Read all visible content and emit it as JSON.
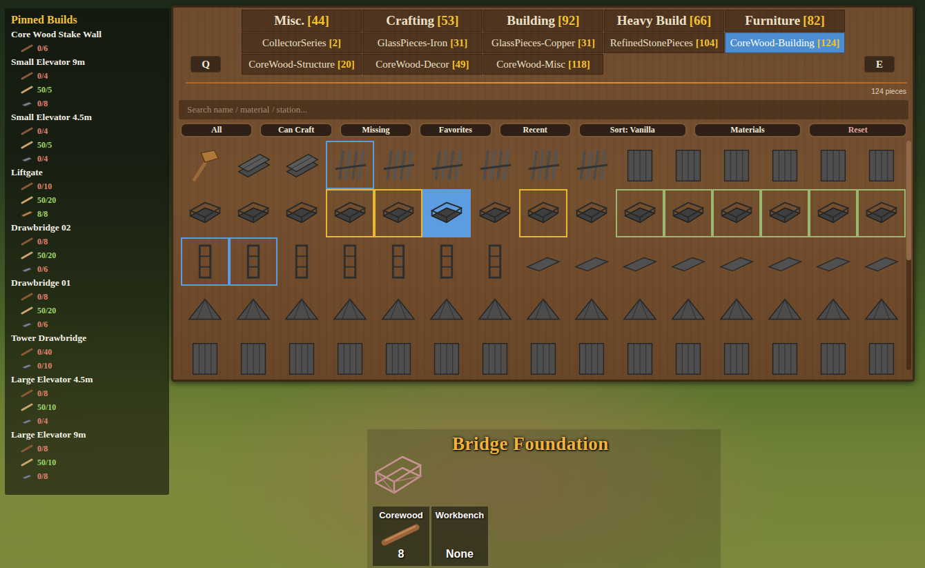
{
  "pinned": {
    "title": "Pinned Builds",
    "items": [
      {
        "name": "Core Wood Stake Wall",
        "requirements": [
          {
            "kind": "corewood",
            "amount": "0/6",
            "met": false
          }
        ]
      },
      {
        "name": "Small Elevator 9m",
        "requirements": [
          {
            "kind": "corewood",
            "amount": "0/4",
            "met": false
          },
          {
            "kind": "finewood",
            "amount": "50/5",
            "met": true
          },
          {
            "kind": "metal",
            "amount": "0/8",
            "met": false
          }
        ]
      },
      {
        "name": "Small Elevator 4.5m",
        "requirements": [
          {
            "kind": "corewood",
            "amount": "0/4",
            "met": false
          },
          {
            "kind": "finewood",
            "amount": "50/5",
            "met": true
          },
          {
            "kind": "metal",
            "amount": "0/4",
            "met": false
          }
        ]
      },
      {
        "name": "Liftgate",
        "requirements": [
          {
            "kind": "corewood",
            "amount": "0/10",
            "met": false
          },
          {
            "kind": "finewood",
            "amount": "50/20",
            "met": true
          },
          {
            "kind": "plank",
            "amount": "8/8",
            "met": true
          }
        ]
      },
      {
        "name": "Drawbridge 02",
        "requirements": [
          {
            "kind": "corewood",
            "amount": "0/8",
            "met": false
          },
          {
            "kind": "finewood",
            "amount": "50/20",
            "met": true
          },
          {
            "kind": "metal",
            "amount": "0/6",
            "met": false
          }
        ]
      },
      {
        "name": "Drawbridge 01",
        "requirements": [
          {
            "kind": "corewood",
            "amount": "0/8",
            "met": false
          },
          {
            "kind": "finewood",
            "amount": "50/20",
            "met": true
          },
          {
            "kind": "metal",
            "amount": "0/6",
            "met": false
          }
        ]
      },
      {
        "name": "Tower Drawbridge",
        "requirements": [
          {
            "kind": "corewood",
            "amount": "0/40",
            "met": false
          },
          {
            "kind": "metal",
            "amount": "0/10",
            "met": false
          }
        ]
      },
      {
        "name": "Large Elevator 4.5m",
        "requirements": [
          {
            "kind": "corewood",
            "amount": "0/8",
            "met": false
          },
          {
            "kind": "finewood",
            "amount": "50/10",
            "met": true
          },
          {
            "kind": "metal",
            "amount": "0/4",
            "met": false
          }
        ]
      },
      {
        "name": "Large Elevator 9m",
        "requirements": [
          {
            "kind": "corewood",
            "amount": "0/8",
            "met": false
          },
          {
            "kind": "finewood",
            "amount": "50/10",
            "met": true
          },
          {
            "kind": "metal",
            "amount": "0/8",
            "met": false
          }
        ]
      }
    ]
  },
  "nav": {
    "prev": "Q",
    "next": "E"
  },
  "tabs": [
    {
      "label": "Misc.",
      "count": "[44]",
      "selected": false,
      "size": "large"
    },
    {
      "label": "Crafting",
      "count": "[53]",
      "selected": false,
      "size": "large"
    },
    {
      "label": "Building",
      "count": "[92]",
      "selected": false,
      "size": "large"
    },
    {
      "label": "Heavy Build",
      "count": "[66]",
      "selected": false,
      "size": "large"
    },
    {
      "label": "Furniture",
      "count": "[82]",
      "selected": false,
      "size": "large"
    },
    {
      "label": "CollectorSeries",
      "count": "[2]",
      "selected": false,
      "size": "small"
    },
    {
      "label": "GlassPieces-Iron",
      "count": "[31]",
      "selected": false,
      "size": "small"
    },
    {
      "label": "GlassPieces-Copper",
      "count": "[31]",
      "selected": false,
      "size": "small"
    },
    {
      "label": "RefinedStonePieces",
      "count": "[104]",
      "selected": false,
      "size": "small"
    },
    {
      "label": "CoreWood-Building",
      "count": "[124]",
      "selected": true,
      "size": "small"
    },
    {
      "label": "CoreWood-Structure",
      "count": "[20]",
      "selected": false,
      "size": "small"
    },
    {
      "label": "CoreWood-Decor",
      "count": "[49]",
      "selected": false,
      "size": "small"
    },
    {
      "label": "CoreWood-Misc",
      "count": "[118]",
      "selected": false,
      "size": "small"
    }
  ],
  "piece_count": "124 pieces",
  "search": {
    "placeholder": "Search name / material / station..."
  },
  "filters": [
    {
      "label": "All",
      "kind": "normal"
    },
    {
      "label": "Can Craft",
      "kind": "normal"
    },
    {
      "label": "Missing",
      "kind": "normal"
    },
    {
      "label": "Favorites",
      "kind": "normal"
    },
    {
      "label": "Recent",
      "kind": "normal"
    },
    {
      "label": "Sort: Vanilla",
      "kind": "normal"
    },
    {
      "label": "Materials",
      "kind": "normal"
    },
    {
      "label": "Reset",
      "kind": "reset"
    }
  ],
  "pieces": [
    {
      "selected": false,
      "color": ""
    },
    {
      "selected": false,
      "color": ""
    },
    {
      "selected": false,
      "color": ""
    },
    {
      "selected": false,
      "color": "#5b9de0"
    },
    {
      "selected": false,
      "color": ""
    },
    {
      "selected": false,
      "color": ""
    },
    {
      "selected": false,
      "color": ""
    },
    {
      "selected": false,
      "color": ""
    },
    {
      "selected": false,
      "color": ""
    },
    {
      "selected": false,
      "color": ""
    },
    {
      "selected": false,
      "color": ""
    },
    {
      "selected": false,
      "color": ""
    },
    {
      "selected": false,
      "color": ""
    },
    {
      "selected": false,
      "color": ""
    },
    {
      "selected": false,
      "color": ""
    },
    {
      "selected": false,
      "color": ""
    },
    {
      "selected": false,
      "color": ""
    },
    {
      "selected": false,
      "color": ""
    },
    {
      "selected": false,
      "color": "#e8b830"
    },
    {
      "selected": false,
      "color": "#e8b830"
    },
    {
      "selected": true,
      "color": "#5b9de0"
    },
    {
      "selected": false,
      "color": ""
    },
    {
      "selected": false,
      "color": "#e8b830"
    },
    {
      "selected": false,
      "color": ""
    },
    {
      "selected": false,
      "color": "#9ab870"
    },
    {
      "selected": false,
      "color": "#9ab870"
    },
    {
      "selected": false,
      "color": "#9ab870"
    },
    {
      "selected": false,
      "color": "#9ab870"
    },
    {
      "selected": false,
      "color": "#9ab870"
    },
    {
      "selected": false,
      "color": "#9ab870"
    },
    {
      "selected": false,
      "color": "#5b9de0"
    },
    {
      "selected": false,
      "color": "#5b9de0"
    },
    {
      "selected": false,
      "color": ""
    },
    {
      "selected": false,
      "color": ""
    },
    {
      "selected": false,
      "color": ""
    },
    {
      "selected": false,
      "color": ""
    },
    {
      "selected": false,
      "color": ""
    },
    {
      "selected": false,
      "color": ""
    },
    {
      "selected": false,
      "color": ""
    },
    {
      "selected": false,
      "color": ""
    },
    {
      "selected": false,
      "color": ""
    },
    {
      "selected": false,
      "color": ""
    },
    {
      "selected": false,
      "color": ""
    },
    {
      "selected": false,
      "color": ""
    },
    {
      "selected": false,
      "color": ""
    },
    {
      "selected": false,
      "color": ""
    },
    {
      "selected": false,
      "color": ""
    },
    {
      "selected": false,
      "color": ""
    },
    {
      "selected": false,
      "color": ""
    },
    {
      "selected": false,
      "color": ""
    },
    {
      "selected": false,
      "color": ""
    },
    {
      "selected": false,
      "color": ""
    },
    {
      "selected": false,
      "color": ""
    },
    {
      "selected": false,
      "color": ""
    },
    {
      "selected": false,
      "color": ""
    },
    {
      "selected": false,
      "color": ""
    },
    {
      "selected": false,
      "color": ""
    },
    {
      "selected": false,
      "color": ""
    },
    {
      "selected": false,
      "color": ""
    },
    {
      "selected": false,
      "color": ""
    },
    {
      "selected": false,
      "color": ""
    },
    {
      "selected": false,
      "color": ""
    },
    {
      "selected": false,
      "color": ""
    },
    {
      "selected": false,
      "color": ""
    },
    {
      "selected": false,
      "color": ""
    },
    {
      "selected": false,
      "color": ""
    },
    {
      "selected": false,
      "color": ""
    },
    {
      "selected": false,
      "color": ""
    },
    {
      "selected": false,
      "color": ""
    },
    {
      "selected": false,
      "color": ""
    },
    {
      "selected": false,
      "color": ""
    },
    {
      "selected": false,
      "color": ""
    },
    {
      "selected": false,
      "color": ""
    },
    {
      "selected": false,
      "color": ""
    },
    {
      "selected": false,
      "color": ""
    }
  ],
  "scrollbar": {
    "level": 0.52
  },
  "selected_piece": {
    "name": "Bridge Foundation",
    "requirements": [
      {
        "label": "Corewood",
        "amount": "8",
        "kind": "corewood"
      },
      {
        "label": "Workbench",
        "amount": "None",
        "kind": "station"
      }
    ]
  }
}
